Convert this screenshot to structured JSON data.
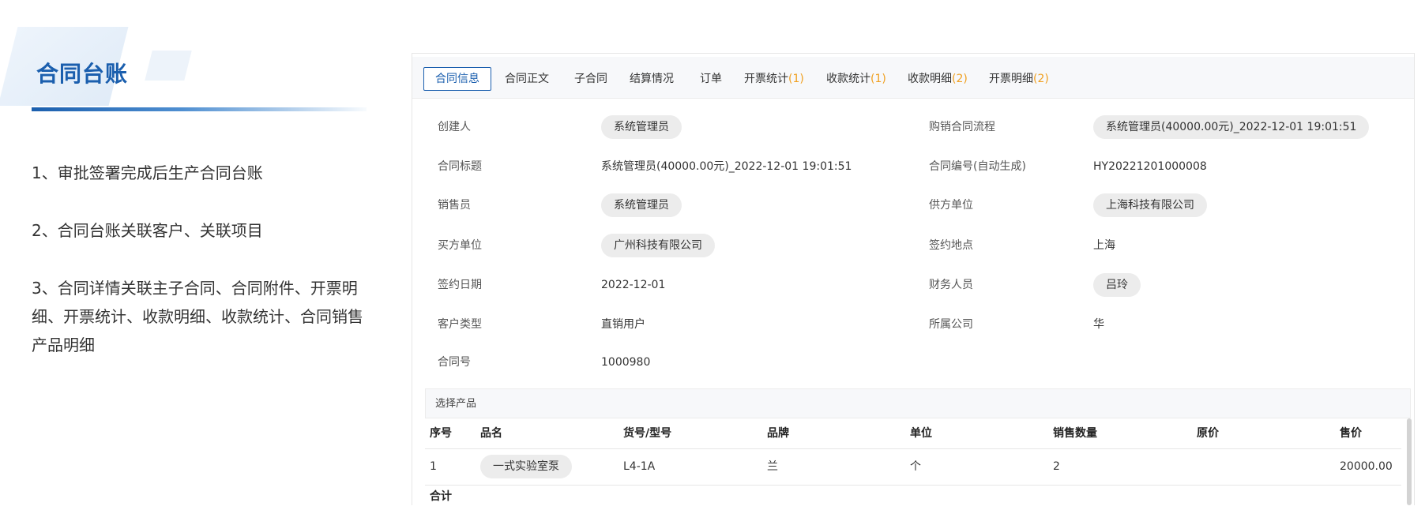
{
  "slide": {
    "title": "合同台账",
    "bullets": [
      "1、审批签署完成后生产合同台账",
      "2、合同台账关联客户、关联项目",
      "3、合同详情关联主子合同、合同附件、开票明细、开票统计、收款明细、收款统计、合同销售产品明细"
    ]
  },
  "tabs": [
    {
      "label": "合同信息",
      "count": ""
    },
    {
      "label": "合同正文",
      "count": ""
    },
    {
      "label": "子合同",
      "count": ""
    },
    {
      "label": "结算情况",
      "count": ""
    },
    {
      "label": "订单",
      "count": ""
    },
    {
      "label": "开票统计",
      "count": "(1)"
    },
    {
      "label": "收款统计",
      "count": "(1)"
    },
    {
      "label": "收款明细",
      "count": "(2)"
    },
    {
      "label": "开票明细",
      "count": "(2)"
    }
  ],
  "fields": {
    "creator": {
      "label": "创建人",
      "value": "系统管理员"
    },
    "flow": {
      "label": "购销合同流程",
      "value": "系统管理员(40000.00元)_2022-12-01 19:01:51"
    },
    "title": {
      "label": "合同标题",
      "value": "系统管理员(40000.00元)_2022-12-01 19:01:51"
    },
    "code": {
      "label": "合同编号(自动生成)",
      "value": "HY20221201000008"
    },
    "sales": {
      "label": "销售员",
      "value": "系统管理员"
    },
    "supplier": {
      "label": "供方单位",
      "value": "上海科技有限公司"
    },
    "buyer": {
      "label": "买方单位",
      "value": "广州科技有限公司"
    },
    "place": {
      "label": "签约地点",
      "value": "上海"
    },
    "date": {
      "label": "签约日期",
      "value": "2022-12-01"
    },
    "finance": {
      "label": "财务人员",
      "value": "吕玲"
    },
    "ctype": {
      "label": "客户类型",
      "value": "直销用户"
    },
    "company": {
      "label": "所属公司",
      "value": "华"
    },
    "number": {
      "label": "合同号",
      "value": "1000980"
    }
  },
  "products": {
    "section_label": "选择产品",
    "columns": [
      "序号",
      "品名",
      "货号/型号",
      "品牌",
      "单位",
      "销售数量",
      "原价",
      "售价"
    ],
    "rows": [
      [
        "1",
        "一式实验室泵",
        "L4-1A",
        "兰",
        "个",
        "2",
        "",
        "20000.00"
      ]
    ],
    "total_label": "合计"
  }
}
